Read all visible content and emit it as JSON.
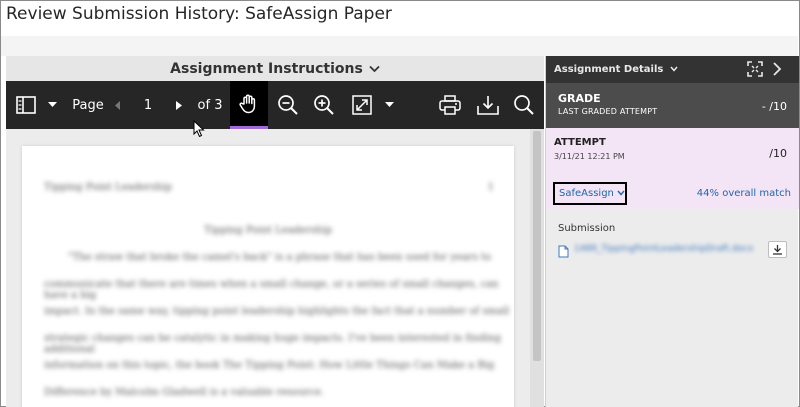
{
  "page_title": "Review Submission History: SafeAssign Paper",
  "instructions_bar": {
    "label": "Assignment Instructions"
  },
  "toolbar": {
    "page_label": "Page",
    "page_current": "1",
    "page_total": "of 3"
  },
  "document": {
    "header": "Tipping Point Leadership",
    "page_number": "1",
    "title": "Tipping Point Leadership",
    "lines": [
      "\"The straw that broke the camel's back\" is a phrase that has been used for years to",
      "communicate that there are times when a small change, or a series of small changes, can have a big",
      "impact. In the same way, tipping point leadership highlights the fact that a number of small",
      "strategic changes can be catalytic in making huge impacts. I've been interested in finding additional",
      "information on this topic, the book The Tipping Point: How Little Things Can Make a Big",
      "Difference by Malcolm Gladwell is a valuable resource."
    ]
  },
  "details_panel": {
    "header_label": "Assignment Details",
    "grade": {
      "label": "GRADE",
      "sublabel": "LAST GRADED ATTEMPT",
      "value": "- /10"
    },
    "attempt": {
      "label": "ATTEMPT",
      "timestamp": "3/11/21 12:21 PM",
      "value": "/10"
    },
    "safeassign_label": "SafeAssign",
    "match_label": "44% overall match",
    "submission_label": "Submission",
    "submission_file": "1489_TippingPointLeadershipDraft.docx"
  },
  "colors": {
    "toolbar_bg": "#262626",
    "active_underline": "#a06bd6",
    "attempt_bg": "#f3e4f6",
    "link": "#2266aa",
    "grade_bg": "#4c4c4c"
  },
  "icons": {
    "sidebar_toggle": "sidebar-panel-icon",
    "pan_tool": "hand-icon",
    "zoom_out": "zoom-out-icon",
    "zoom_in": "zoom-in-icon",
    "fit": "fit-screen-icon",
    "print": "print-icon",
    "download": "download-icon",
    "search": "search-icon",
    "expand": "expand-icon",
    "close_panel": "chevron-right-icon"
  }
}
